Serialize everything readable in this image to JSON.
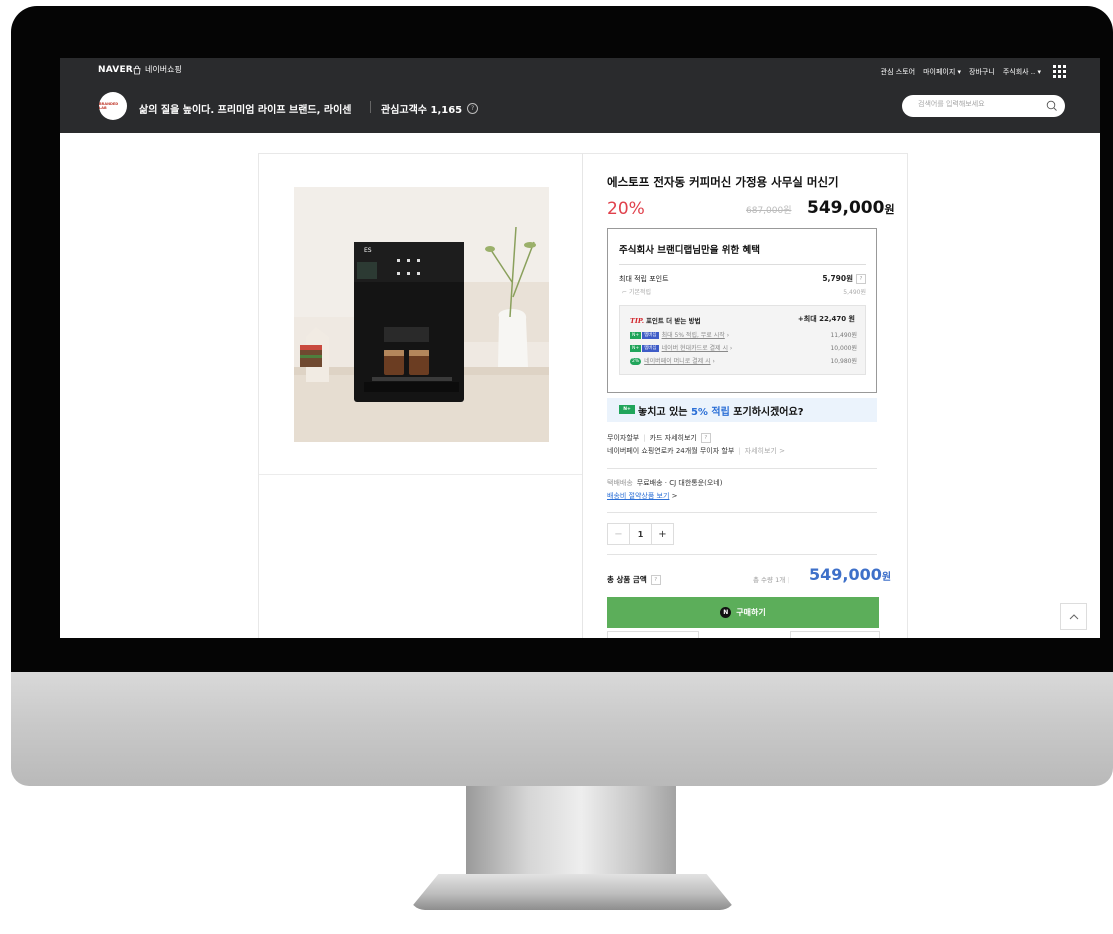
{
  "header": {
    "logo": "NAVER",
    "shopping_label": "네이버쇼핑",
    "menu": [
      "관심 스토어",
      "마이페이지 ▾",
      "장바구니",
      "주식회사 .. ▾"
    ],
    "store_logo_text": "BRANDED LAB",
    "store_name": "삶의 질을 높이다. 프리미엄 라이프 브랜드, 라이센",
    "interest_label": "관심고객수 1,165",
    "search_placeholder": "검색어를 입력해보세요"
  },
  "product": {
    "title": "에스토프 전자동 커피머신 가정용 사무실 머신기",
    "discount": "20%",
    "original_price": "687,000원",
    "sale_price": "549,000",
    "currency": "원"
  },
  "benefits": {
    "title": "주식회사 브랜디랩님만을 위한 혜택",
    "max_points_label": "최대 적립 포인트",
    "max_points_value": "5,790원",
    "base_label": "기본적립",
    "base_value": "5,490원",
    "tip_prefix": "TIP.",
    "tip_title": "포인트 더 받는 방법",
    "tip_max": "+최대 22,470 원",
    "tips": [
      {
        "badge": "N+",
        "badge2": "멤버십",
        "text": "최대 5% 적립, 무료 시작",
        "amount": "11,490원"
      },
      {
        "badge": "N+",
        "badge2": "멤버십",
        "text": "네이버 현대카드로 결제 시",
        "amount": "10,000원"
      },
      {
        "badge": "2%",
        "badge2": "",
        "text": "네이버페이 머니로 결제 시",
        "amount": "10,980원"
      }
    ]
  },
  "banner": {
    "badge": "N+",
    "text_before": "놓치고 있는 ",
    "highlight": "5% 적립",
    "text_after": " 포기하시겠어요?"
  },
  "payment": {
    "installment_label": "무이자할부",
    "card_details": "카드 자세히보기",
    "installment_info": "네이버페이 쇼핑연로카 24개월 무이자 할부",
    "view_more": "자세히보기 >"
  },
  "shipping": {
    "type": "택배배송",
    "info": "무료배송 · CJ 대한통운(오네)",
    "bundle_link": "배송비 절약상품 보기",
    "bundle_arrow": ">"
  },
  "quantity": {
    "minus": "−",
    "value": "1",
    "plus": "+"
  },
  "total": {
    "label": "총 상품 금액",
    "qty_text": "총 수량 1개",
    "price": "549,000",
    "currency": "원"
  },
  "buy_button_label": "구매하기",
  "colors": {
    "header_bg": "#2a2b2d",
    "discount": "#e0404b",
    "total_price": "#3e70c9",
    "buy_button": "#5cae5a",
    "naver_green": "#21a55b"
  }
}
